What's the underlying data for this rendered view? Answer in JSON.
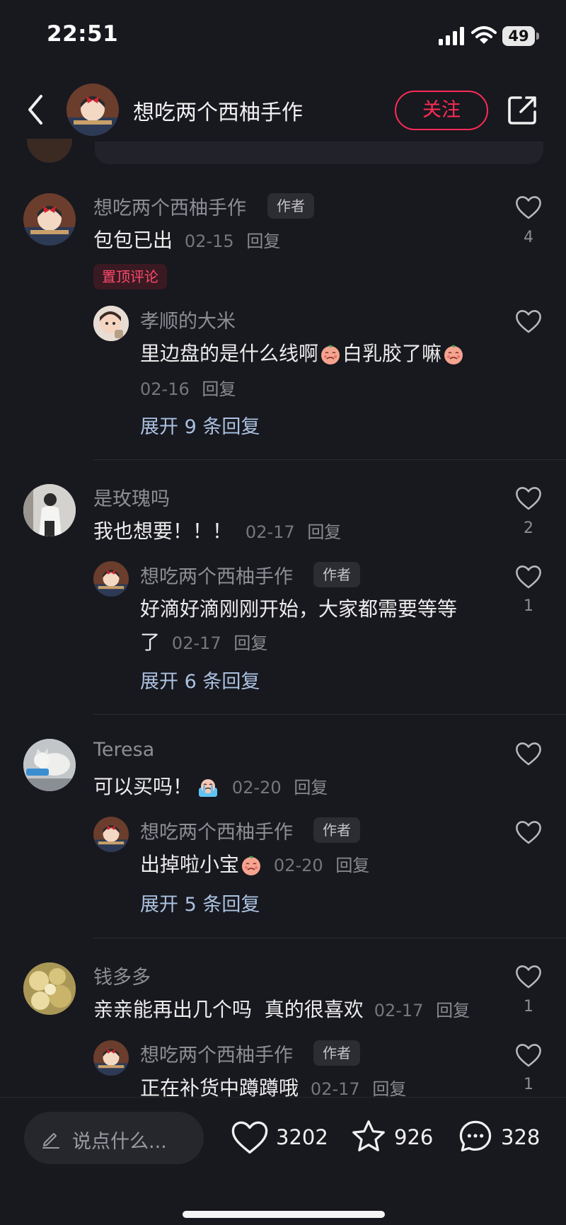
{
  "status_bar": {
    "time": "22:51",
    "battery": "49"
  },
  "header": {
    "title": "想吃两个西柚手作",
    "follow_label": "关注"
  },
  "comments": [
    {
      "user": "想吃两个西柚手作",
      "author_tag": "作者",
      "text": "包包已出",
      "date": "02-15",
      "reply_label": "回复",
      "likes": "4",
      "pinned_label": "置顶评论",
      "replies": [
        {
          "user": "孝顺的大米",
          "text_a": "里边盘的是什么线啊",
          "text_b": "白乳胶了嘛",
          "date": "02-16",
          "reply_label": "回复"
        }
      ],
      "expand_label": "展开 9 条回复"
    },
    {
      "user": "是玫瑰吗",
      "text": "我也想要！！！",
      "date": "02-17",
      "reply_label": "回复",
      "likes": "2",
      "replies": [
        {
          "user": "想吃两个西柚手作",
          "author_tag": "作者",
          "text_line1": "好滴好滴刚刚开始，大家都需要等等",
          "text_line2": "了",
          "date": "02-17",
          "reply_label": "回复",
          "likes": "1"
        }
      ],
      "expand_label": "展开 6 条回复"
    },
    {
      "user": "Teresa",
      "text": "可以买吗！",
      "date": "02-20",
      "reply_label": "回复",
      "replies": [
        {
          "user": "想吃两个西柚手作",
          "author_tag": "作者",
          "text": "出掉啦小宝",
          "date": "02-20",
          "reply_label": "回复"
        }
      ],
      "expand_label": "展开 5 条回复"
    },
    {
      "user": "钱多多",
      "text": "亲亲能再出几个吗  真的很喜欢",
      "date": "02-17",
      "reply_label": "回复",
      "likes": "1",
      "replies": [
        {
          "user": "想吃两个西柚手作",
          "author_tag": "作者",
          "text": "正在补货中蹲蹲哦",
          "date": "02-17",
          "reply_label": "回复",
          "likes": "1"
        }
      ]
    }
  ],
  "bottom_bar": {
    "input_placeholder": "说点什么...",
    "likes": "3202",
    "favorites": "926",
    "comments": "328"
  },
  "colors": {
    "accent": "#fe2c55",
    "background": "#18181f",
    "expand_link": "#aac2e0"
  },
  "icons": [
    "back-icon",
    "share-icon",
    "heart-icon",
    "star-icon",
    "chat-bubble-icon",
    "pencil-icon",
    "signal-icon",
    "wifi-icon",
    "battery-icon"
  ]
}
